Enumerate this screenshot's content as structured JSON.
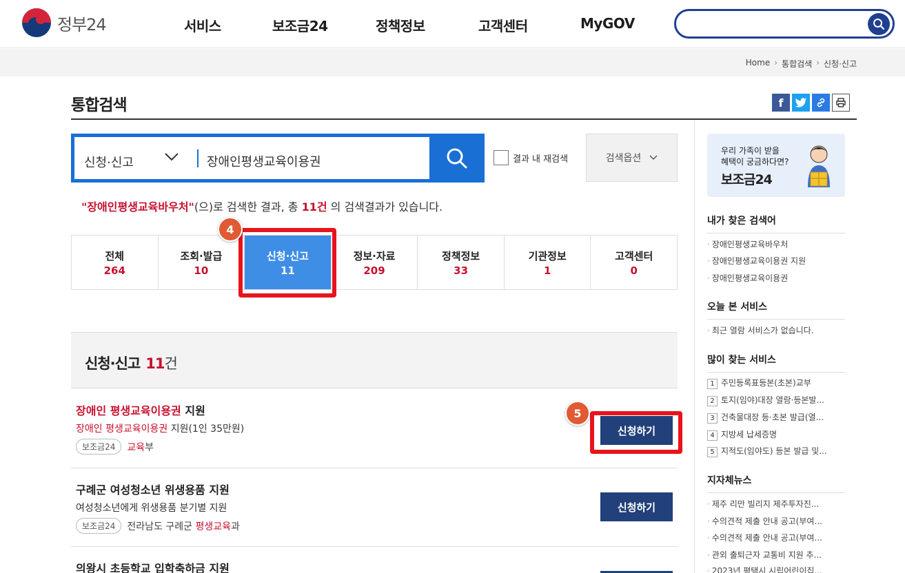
{
  "header": {
    "logo_text": "정부24",
    "nav": [
      "서비스",
      "보조금24",
      "정책정보",
      "고객센터",
      "MyGOV"
    ],
    "search_placeholder": ""
  },
  "breadcrumb": [
    "Home",
    "통합검색",
    "신청·신고"
  ],
  "page_title": "통합검색",
  "share_icons": [
    "facebook-icon",
    "twitter-icon",
    "link-icon",
    "print-icon"
  ],
  "search": {
    "category": "신청·신고",
    "query": "장애인평생교육이용권",
    "research_label": "결과 내 재검색",
    "options_label": "검색옵션"
  },
  "result_message": {
    "keyword": "\"장애인평생교육바우처\"",
    "part1": "(으)로 검색한 결과, 총 ",
    "count": "11건",
    "part2": " 의 검색결과가 있습니다."
  },
  "tabs": [
    {
      "label": "전체",
      "count": "264"
    },
    {
      "label": "조회·발급",
      "count": "10"
    },
    {
      "label": "신청·신고",
      "count": "11"
    },
    {
      "label": "정보·자료",
      "count": "209"
    },
    {
      "label": "정책정보",
      "count": "33"
    },
    {
      "label": "기관정보",
      "count": "1"
    },
    {
      "label": "고객센터",
      "count": "0"
    }
  ],
  "markers": {
    "tab": "4",
    "apply": "5"
  },
  "section": {
    "title": "신청·신고",
    "count": "11",
    "unit": "건"
  },
  "results": [
    {
      "title_hl": "장애인 평생교육이용권",
      "title_rest": " 지원",
      "desc_hl": "장애인 평생교육이용권",
      "desc_rest": " 지원(1인 35만원)",
      "tag": "보조금24",
      "org_pre": "",
      "org_hl": "교육",
      "org_post": "부",
      "button": "신청하기"
    },
    {
      "title_hl": "",
      "title_rest": "구례군 여성청소년 위생용품 지원",
      "desc_hl": "",
      "desc_rest": "여성청소년에게 위생용품 분기별 지원",
      "tag": "보조금24",
      "org_pre": "전라남도 구례군 ",
      "org_hl": "평생교육",
      "org_post": "과",
      "button": "신청하기"
    },
    {
      "title_hl": "",
      "title_rest": "의왕시 초등학교 입학축하금 지원",
      "button": ""
    }
  ],
  "aside": {
    "banner": {
      "line1": "우리 가족이 받을",
      "line2": "혜택이 궁금하다면?",
      "line3": "보조금24"
    },
    "my_search": {
      "title": "내가 찾은 검색어",
      "items": [
        "장애인평생교육바우처",
        "장애인평생교육이용권 지원",
        "장애인평생교육이용권"
      ]
    },
    "today": {
      "title": "오늘 본 서비스",
      "items": [
        "최근 열람 서비스가 없습니다."
      ]
    },
    "popular": {
      "title": "많이 찾는 서비스",
      "items": [
        "주민등록표등본(초본)교부",
        "토지(임야)대장 열람·등본발...",
        "건축물대장 등·초본 발급(열...",
        "지방세 납세증명",
        "지적도(임야도) 등본 발급 및..."
      ]
    },
    "local_news": {
      "title": "지자체뉴스",
      "items": [
        "제주 리만 빌리지 제주투자진...",
        "수의견적 제출 안내 공고(부여...",
        "수의견적 제출 안내 공고(부여...",
        "관외 출퇴근자 교통비 지원 추...",
        "2023년 평택시 시립어린이집..."
      ]
    }
  }
}
